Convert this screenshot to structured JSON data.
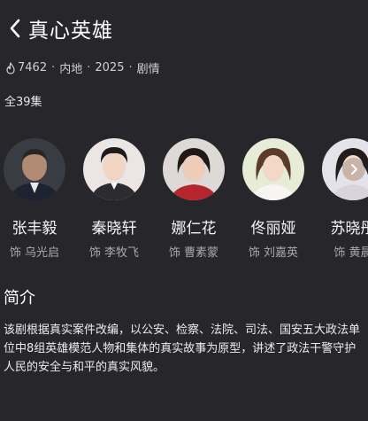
{
  "header": {
    "title": "真心英雄"
  },
  "meta": {
    "views": "7462",
    "region": "内地",
    "year": "2025",
    "genre": "剧情",
    "separator": "·"
  },
  "episodes_label": "全39集",
  "cast": [
    {
      "name": "张丰毅",
      "role": "饰 乌光启",
      "avatar_bg": "#3a3c44"
    },
    {
      "name": "秦晓轩",
      "role": "饰 李牧飞",
      "avatar_bg": "#e9e4e2"
    },
    {
      "name": "娜仁花",
      "role": "饰 曹素蒙",
      "avatar_bg": "#d9d6d3"
    },
    {
      "name": "佟丽娅",
      "role": "饰 刘嘉英",
      "avatar_bg": "#e6ecd6"
    },
    {
      "name": "苏晓彤",
      "role": "饰 黄晨",
      "avatar_bg": "#e4e3ea"
    }
  ],
  "synopsis": {
    "title": "简介",
    "text": "该剧根据真实案件改编，以公安、检察、法院、司法、国安五大政法单位中8组英雄模范人物和集体的真实故事为原型，讲述了政法干警守护人民的安全与和平的真实风貌。"
  },
  "colors": {
    "background": "#27262b",
    "text_primary": "#ffffff",
    "text_secondary": "#a9a9ae"
  },
  "icons": {
    "back": "chevron-left-icon",
    "views": "flame-icon",
    "scroll": "chevron-right-icon"
  }
}
